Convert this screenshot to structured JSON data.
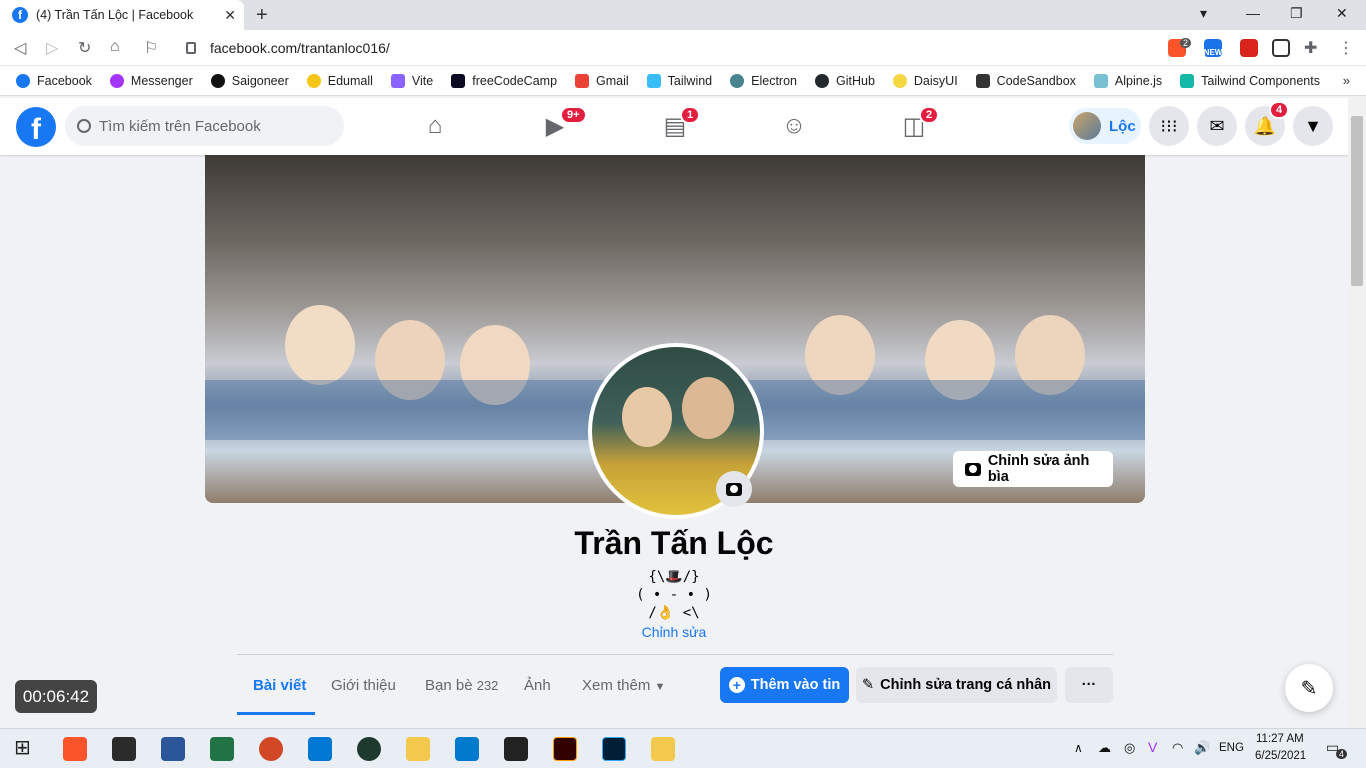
{
  "browser": {
    "tab_title": "(4) Trần Tấn Lộc | Facebook",
    "url": "facebook.com/trantanloc016/",
    "bookmarks": [
      "Facebook",
      "Messenger",
      "Saigoneer",
      "Edumall",
      "Vite",
      "freeCodeCamp",
      "Gmail",
      "Tailwind",
      "Electron",
      "GitHub",
      "DaisyUI",
      "CodeSandbox",
      "Alpine.js",
      "Tailwind Components"
    ],
    "ext_badge_brave": "2",
    "ext_new_label": "NEW"
  },
  "fb_header": {
    "search_placeholder": "Tìm kiếm trên Facebook",
    "watch_badge": "9+",
    "marketplace_badge": "1",
    "gaming_badge": "2",
    "user_short_name": "Lộc",
    "notifications_badge": "4"
  },
  "profile": {
    "edit_cover_label": "Chỉnh sửa ảnh bìa",
    "name": "Trần Tấn Lộc",
    "bio_lines": [
      "{\\🎩/}",
      "( • - • )",
      "/👌 <\\"
    ],
    "bio_edit_label": "Chỉnh sửa",
    "tabs": {
      "posts": "Bài viết",
      "about": "Giới thiệu",
      "friends": "Bạn bè",
      "friends_count": "232",
      "photos": "Ảnh",
      "more": "Xem thêm"
    },
    "add_story_label": "Thêm vào tin",
    "edit_profile_label": "Chỉnh sửa trang cá nhân",
    "more_options_label": "···"
  },
  "overlay": {
    "timer": "00:06:42"
  },
  "taskbar": {
    "language": "ENG",
    "time": "11:27 AM",
    "date": "6/25/2021",
    "notification_count": "4"
  },
  "colors": {
    "fb_blue": "#1877f2",
    "badge_red": "#e41e3f"
  }
}
